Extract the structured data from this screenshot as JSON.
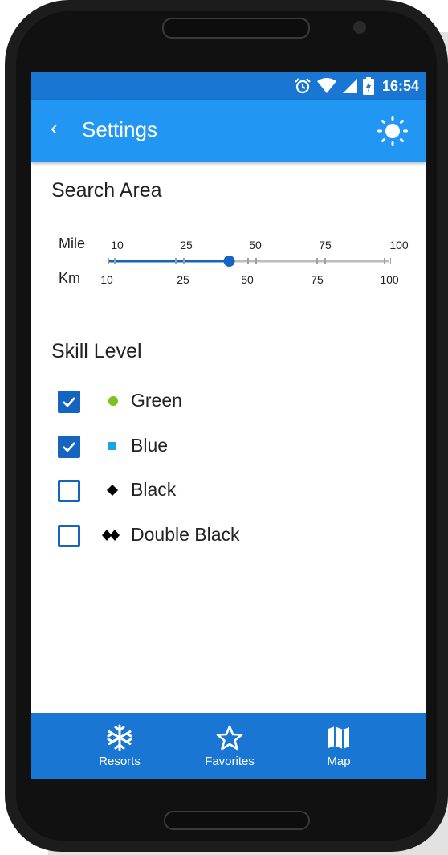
{
  "status_bar": {
    "time": "16:54"
  },
  "app_bar": {
    "title": "Settings"
  },
  "search_area": {
    "title": "Search Area",
    "mile_label": "Mile",
    "km_label": "Km",
    "mile_ticks": [
      "10",
      "25",
      "50",
      "75",
      "100"
    ],
    "km_ticks": [
      "10",
      "25",
      "50",
      "75",
      "100"
    ],
    "slider_value_fraction": 0.43
  },
  "skill_level": {
    "title": "Skill Level",
    "options": [
      {
        "label": "Green",
        "checked": true,
        "symbol": "circle",
        "color": "#7cc21b"
      },
      {
        "label": "Blue",
        "checked": true,
        "symbol": "square",
        "color": "#1aa3e8"
      },
      {
        "label": "Black",
        "checked": false,
        "symbol": "diamond",
        "color": "#000000"
      },
      {
        "label": "Double Black",
        "checked": false,
        "symbol": "double-diamond",
        "color": "#000000"
      }
    ]
  },
  "bottom_nav": {
    "resorts": "Resorts",
    "favorites": "Favorites",
    "map": "Map"
  },
  "colors": {
    "status_bar": "#1976d2",
    "app_bar": "#2196f3",
    "accent": "#1565c0",
    "bottom_bar": "#1976d2"
  }
}
